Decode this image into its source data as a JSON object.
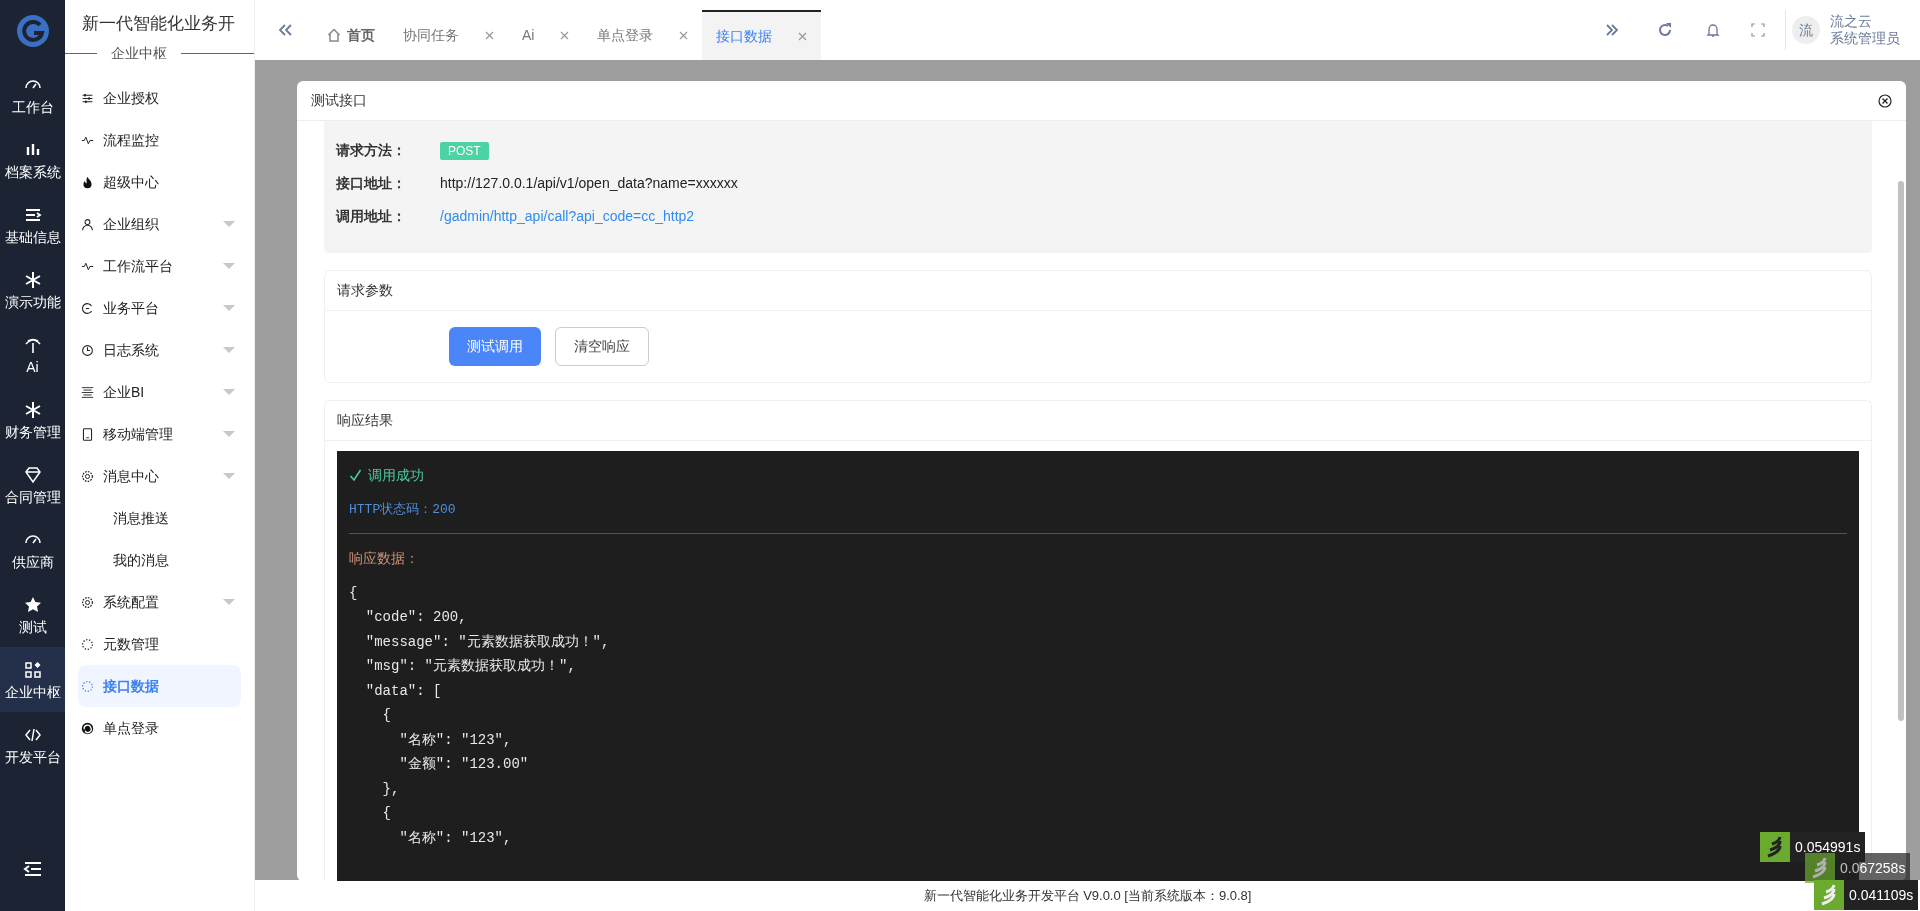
{
  "rail": {
    "items": [
      {
        "label": "工作台",
        "selected": false
      },
      {
        "label": "档案系统",
        "selected": false
      },
      {
        "label": "基础信息",
        "selected": false
      },
      {
        "label": "演示功能",
        "selected": false
      },
      {
        "label": "Ai",
        "selected": false
      },
      {
        "label": "财务管理",
        "selected": false
      },
      {
        "label": "合同管理",
        "selected": false
      },
      {
        "label": "供应商",
        "selected": false
      },
      {
        "label": "测试",
        "selected": false
      },
      {
        "label": "企业中枢",
        "selected": true
      },
      {
        "label": "开发平台",
        "selected": false
      }
    ]
  },
  "sidebar": {
    "title": "新一代智能化业务开",
    "section": "企业中枢",
    "items": [
      {
        "label": "企业授权",
        "caret": false,
        "selected": false
      },
      {
        "label": "流程监控",
        "caret": false,
        "selected": false
      },
      {
        "label": "超级中心",
        "caret": false,
        "selected": false
      },
      {
        "label": "企业组织",
        "caret": true,
        "selected": false
      },
      {
        "label": "工作流平台",
        "caret": true,
        "selected": false
      },
      {
        "label": "业务平台",
        "caret": true,
        "selected": false
      },
      {
        "label": "日志系统",
        "caret": true,
        "selected": false
      },
      {
        "label": "企业BI",
        "caret": true,
        "selected": false
      },
      {
        "label": "移动端管理",
        "caret": true,
        "selected": false
      },
      {
        "label": "消息中心",
        "caret": true,
        "selected": false,
        "children": [
          {
            "label": "消息推送",
            "selected": false
          },
          {
            "label": "我的消息",
            "selected": false
          }
        ]
      },
      {
        "label": "系统配置",
        "caret": true,
        "selected": false
      },
      {
        "label": "元数管理",
        "caret": false,
        "selected": false
      },
      {
        "label": "接口数据",
        "caret": false,
        "selected": true
      },
      {
        "label": "单点登录",
        "caret": false,
        "selected": false
      }
    ]
  },
  "tabs": [
    {
      "label": "首页",
      "closable": false,
      "selected": false
    },
    {
      "label": "协同任务",
      "closable": true,
      "selected": false
    },
    {
      "label": "Ai",
      "closable": true,
      "selected": false
    },
    {
      "label": "单点登录",
      "closable": true,
      "selected": false
    },
    {
      "label": "接口数据",
      "closable": true,
      "selected": true
    }
  ],
  "user": {
    "avatar": "流",
    "name": "流之云",
    "role": "系统管理员"
  },
  "modal": {
    "title": "测试接口",
    "info": [
      {
        "label": "请求方法：",
        "value": "POST",
        "kind": "badge"
      },
      {
        "label": "接口地址：",
        "value": "http://127.0.0.1/api/v1/open_data?name=xxxxxx",
        "kind": "text"
      },
      {
        "label": "调用地址：",
        "value": "/gadmin/http_api/call?api_code=cc_http2",
        "kind": "link"
      }
    ],
    "params": {
      "title": "请求参数",
      "buttons": [
        {
          "label": "测试调用",
          "primary": true
        },
        {
          "label": "清空响应",
          "primary": false
        }
      ]
    },
    "response": {
      "title": "响应结果",
      "status": "调用成功",
      "http_status": "HTTP状态码：200",
      "data_label": "响应数据：",
      "lines": [
        "{",
        "  \"code\": 200,",
        "  \"message\": \"元素数据获取成功！\",",
        "  \"msg\": \"元素数据获取成功！\",",
        "  \"data\": [",
        "    {",
        "      \"名称\": \"123\",",
        "      \"金额\": \"123.00\"",
        "    },",
        "    {",
        "      \"名称\": \"123\","
      ]
    }
  },
  "footer": "新一代智能化业务开发平台 V9.0.0 [当前系统版本：9.0.8]",
  "timings": [
    "0.054991s",
    "0.067258s",
    "0.041109s"
  ]
}
